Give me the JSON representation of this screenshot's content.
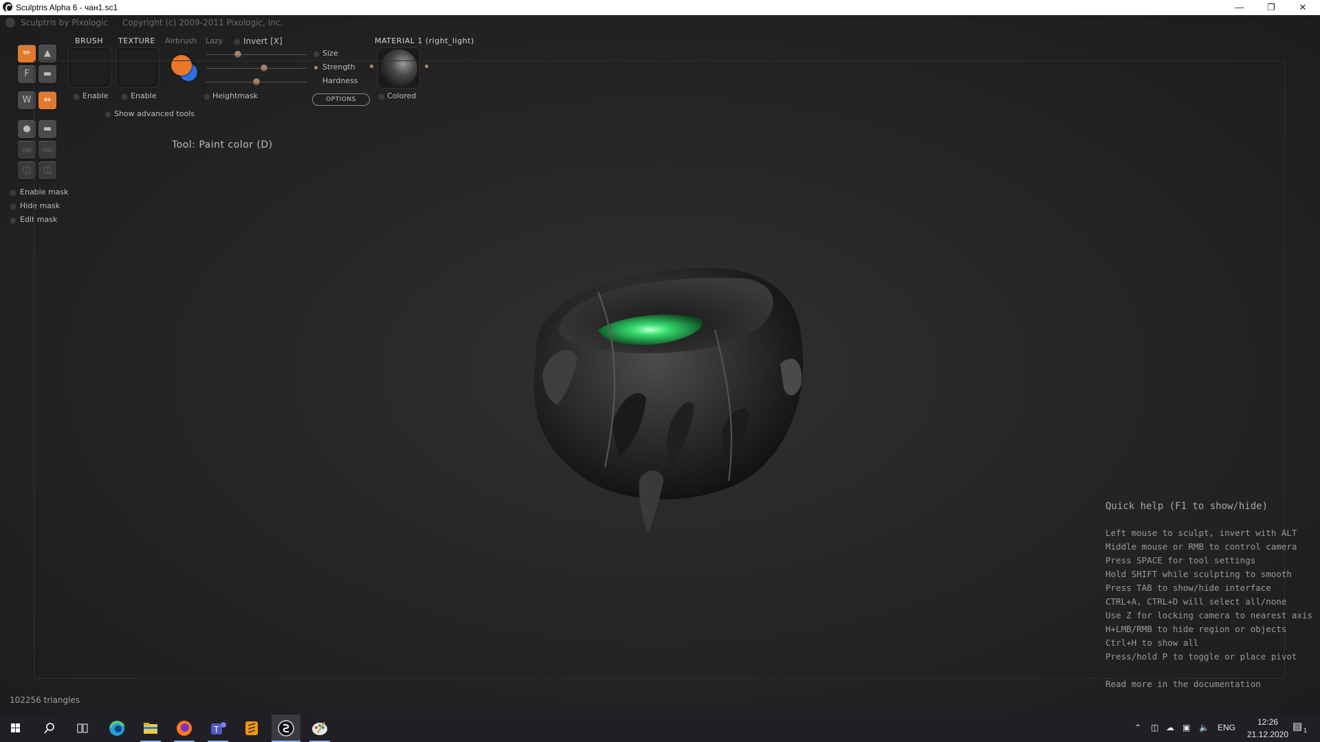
{
  "window": {
    "title": "Sculptris Alpha 6 - чан1.sc1"
  },
  "header": {
    "app_name": "Sculptris by Pixologic",
    "copyright": "Copyright (c) 2009-2011 Pixologic, Inc."
  },
  "brush_panel": {
    "brush_label": "BRUSH",
    "texture_label": "TEXTURE",
    "airbrush_label": "Airbrush",
    "lazy_label": "Lazy",
    "invert_label": "Invert [X]",
    "enable_brush": "Enable",
    "enable_texture": "Enable",
    "heightmask_label": "Heightmask",
    "show_advanced": "Show advanced tools",
    "size_label": "Size",
    "strength_label": "Strength",
    "hardness_label": "Hardness",
    "options_label": "OPTIONS",
    "material_label": "MATERIAL 1 (right_light)",
    "colored_label": "Colored",
    "primary_color": "#e8782a",
    "secondary_color": "#2f6fe0",
    "sliders": {
      "size": 0.3,
      "strength": 0.58,
      "hardness": 0.5
    }
  },
  "tools": {
    "current_tool": "Tool: Paint color (D)",
    "buttons": [
      "paint-brush",
      "bump",
      "flatten",
      "smooth",
      "pattern",
      "swap-colors",
      "sphere",
      "plane",
      "import",
      "export",
      "open",
      "save"
    ],
    "f_glyph": "F"
  },
  "mask": {
    "enable": "Enable mask",
    "hide": "Hide mask",
    "edit": "Edit mask"
  },
  "status": {
    "triangles": "102256 triangles"
  },
  "quick_help": {
    "title": "Quick help (F1 to show/hide)",
    "lines": [
      "Left mouse to sculpt, invert with ALT",
      "Middle mouse or RMB to control camera",
      "Press SPACE for tool settings",
      "Hold SHIFT while sculpting to smooth",
      "Press TAB to show/hide interface",
      "CTRL+A, CTRL+D will select all/none",
      "Use Z for locking camera to nearest axis",
      "H+LMB/RMB to hide region or objects",
      "Ctrl+H to show all",
      "Press/hold P to toggle or place pivot"
    ],
    "docs": "Read more in the documentation"
  },
  "taskbar": {
    "apps": [
      "windows-start",
      "search",
      "task-view",
      "edge",
      "file-explorer",
      "firefox",
      "teams",
      "sublime-text",
      "sculptris",
      "paint"
    ],
    "lang": "ENG",
    "time": "12:26",
    "date": "21.12.2020",
    "notif_count": "1"
  }
}
